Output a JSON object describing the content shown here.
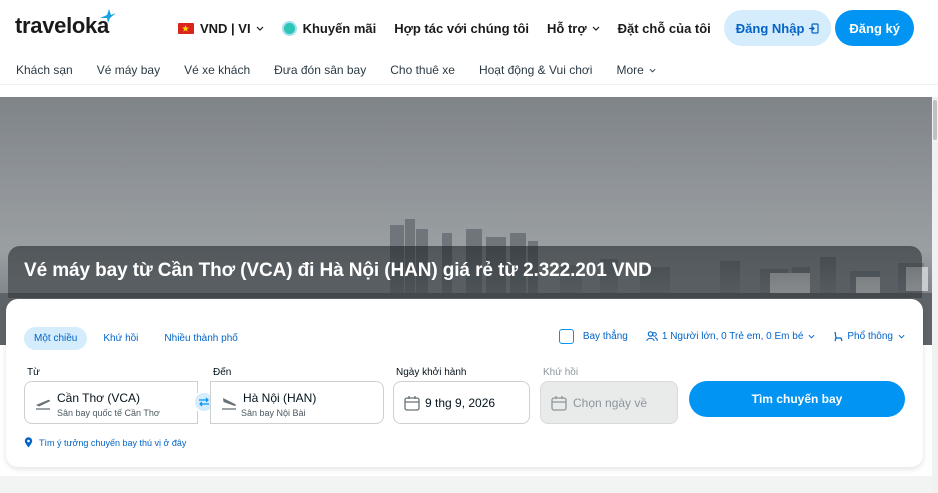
{
  "header": {
    "logo": "traveloka",
    "currency": "VND | VI",
    "promo": "Khuyến mãi",
    "partner": "Hợp tác với chúng tôi",
    "support": "Hỗ trợ",
    "bookings": "Đặt chỗ của tôi",
    "login": "Đăng Nhập",
    "register": "Đăng ký"
  },
  "subnav": [
    "Khách sạn",
    "Vé máy bay",
    "Vé xe khách",
    "Đưa đón sân bay",
    "Cho thuê xe",
    "Hoạt động & Vui chơi",
    "More"
  ],
  "hero": {
    "headline": "Vé máy bay từ Cần Thơ (VCA) đi Hà Nội (HAN) giá rẻ từ 2.322.201 VND"
  },
  "search": {
    "trip_types": [
      "Một chiều",
      "Khứ hồi",
      "Nhiều thành phố"
    ],
    "direct": "Bay thẳng",
    "passengers": "1 Người lớn, 0 Trẻ em, 0 Em bé",
    "cabin": "Phổ thông",
    "from_label": "Từ",
    "from_city": "Cần Thơ (VCA)",
    "from_airport": "Sân bay quốc tế Cần Thơ",
    "to_label": "Đến",
    "to_city": "Hà Nội (HAN)",
    "to_airport": "Sân bay Nội Bài",
    "depart_label": "Ngày khởi hành",
    "depart_date": "9 thg 9, 2026",
    "return_label": "Khứ hồi",
    "return_placeholder": "Chọn ngày về",
    "button": "Tìm chuyến bay",
    "suggest": "Tìm ý tưởng chuyến bay thú vị ở đây"
  },
  "colors": {
    "brand": "#0194f3",
    "brand_dark": "#0264c8",
    "brand_light": "#d4ecfb"
  }
}
